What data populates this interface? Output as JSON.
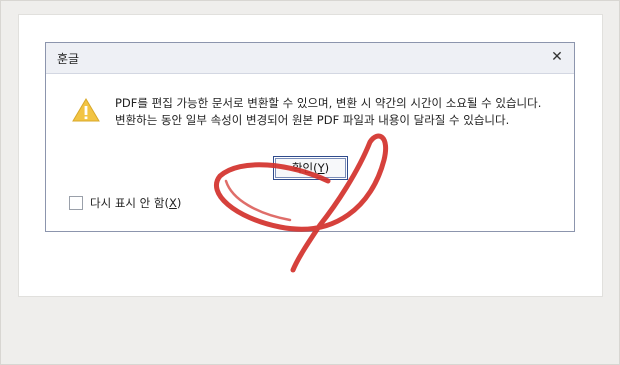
{
  "dialog": {
    "title": "훈글",
    "close_icon": "close-icon",
    "message_line1": "PDF를 편집 가능한 문서로 변환할 수 있으며, 변환 시 약간의 시간이 소요될 수 있습니다.",
    "message_line2": "변환하는 동안 일부 속성이 변경되어 원본 PDF 파일과 내용이 달라질 수 있습니다.",
    "ok_label": "확인",
    "ok_accel": "Y",
    "dont_show_label": "다시 표시 안 함",
    "dont_show_accel": "X",
    "dont_show_checked": false,
    "warning_icon": "warning-icon"
  },
  "colors": {
    "warning": "#f2c443",
    "annotation": "#d2312b"
  }
}
